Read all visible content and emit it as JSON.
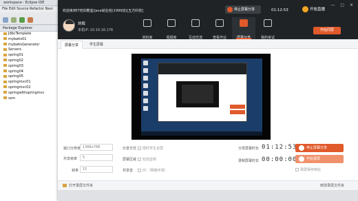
{
  "eclipse": {
    "title": "workspace - Eclipse IDE",
    "menu": "File  Edit  Source  Refactor  Navi",
    "package_explorer_title": "Package Explorer",
    "projects": [
      "JdbcTemplate",
      "mybatis01",
      "mybatisGenerator",
      "Servers",
      "spring01",
      "spring02",
      "spring03",
      "spring04",
      "spring05",
      "springmvc01",
      "springmvc02",
      "springwithspringmvc",
      "ssm"
    ]
  },
  "app": {
    "title": "欢迎来到IT培训教室/java就业班(1999班)[五方科技]",
    "status_pill": "停止屏幕分享",
    "time": "01:12:53",
    "live_label": "开始直播",
    "window_controls": "— ▢ ✕",
    "user": {
      "name": "刘辉",
      "ip": "本机IP: 10.10.16.176"
    },
    "nav": [
      {
        "label": "资料库"
      },
      {
        "label": "视频库"
      },
      {
        "label": "互动交流"
      },
      {
        "label": "查看作业"
      },
      {
        "label": "屏幕分享"
      },
      {
        "label": "我的考试"
      }
    ],
    "active_nav_index": 4,
    "camera_button": "开始同屏",
    "tabs": [
      "屏幕分享",
      "学生屏幕"
    ],
    "settings": {
      "resolution_label": "窗口分辨率",
      "resolution_value": "1366x768",
      "fps_label": "共享帧率",
      "fps_value": "5",
      "quality_label": "帧率",
      "quality_value": "15",
      "share_mode_label": "分享方式",
      "share_mode_check": "限时学生全屏",
      "share_area_label": "屏幕区域",
      "share_area_check": "包括音频",
      "audio_label": "共享音",
      "audio_check": "PC（网络环境）",
      "share_time_label": "分享屏幕时长",
      "share_time": "01:12:53",
      "record_time_label": "录制屏幕时长",
      "record_time": "00:00:00",
      "stop_share_button": "停止屏幕分享",
      "start_record_button": "开始录屏",
      "record_hint": "录屏保存到此"
    },
    "footer": {
      "open_folder": "打开录屏文件夹",
      "change_folder": "修改录屏文件夹"
    }
  },
  "colors": {
    "accent": "#e05a2b",
    "topbar": "#1f2326"
  }
}
